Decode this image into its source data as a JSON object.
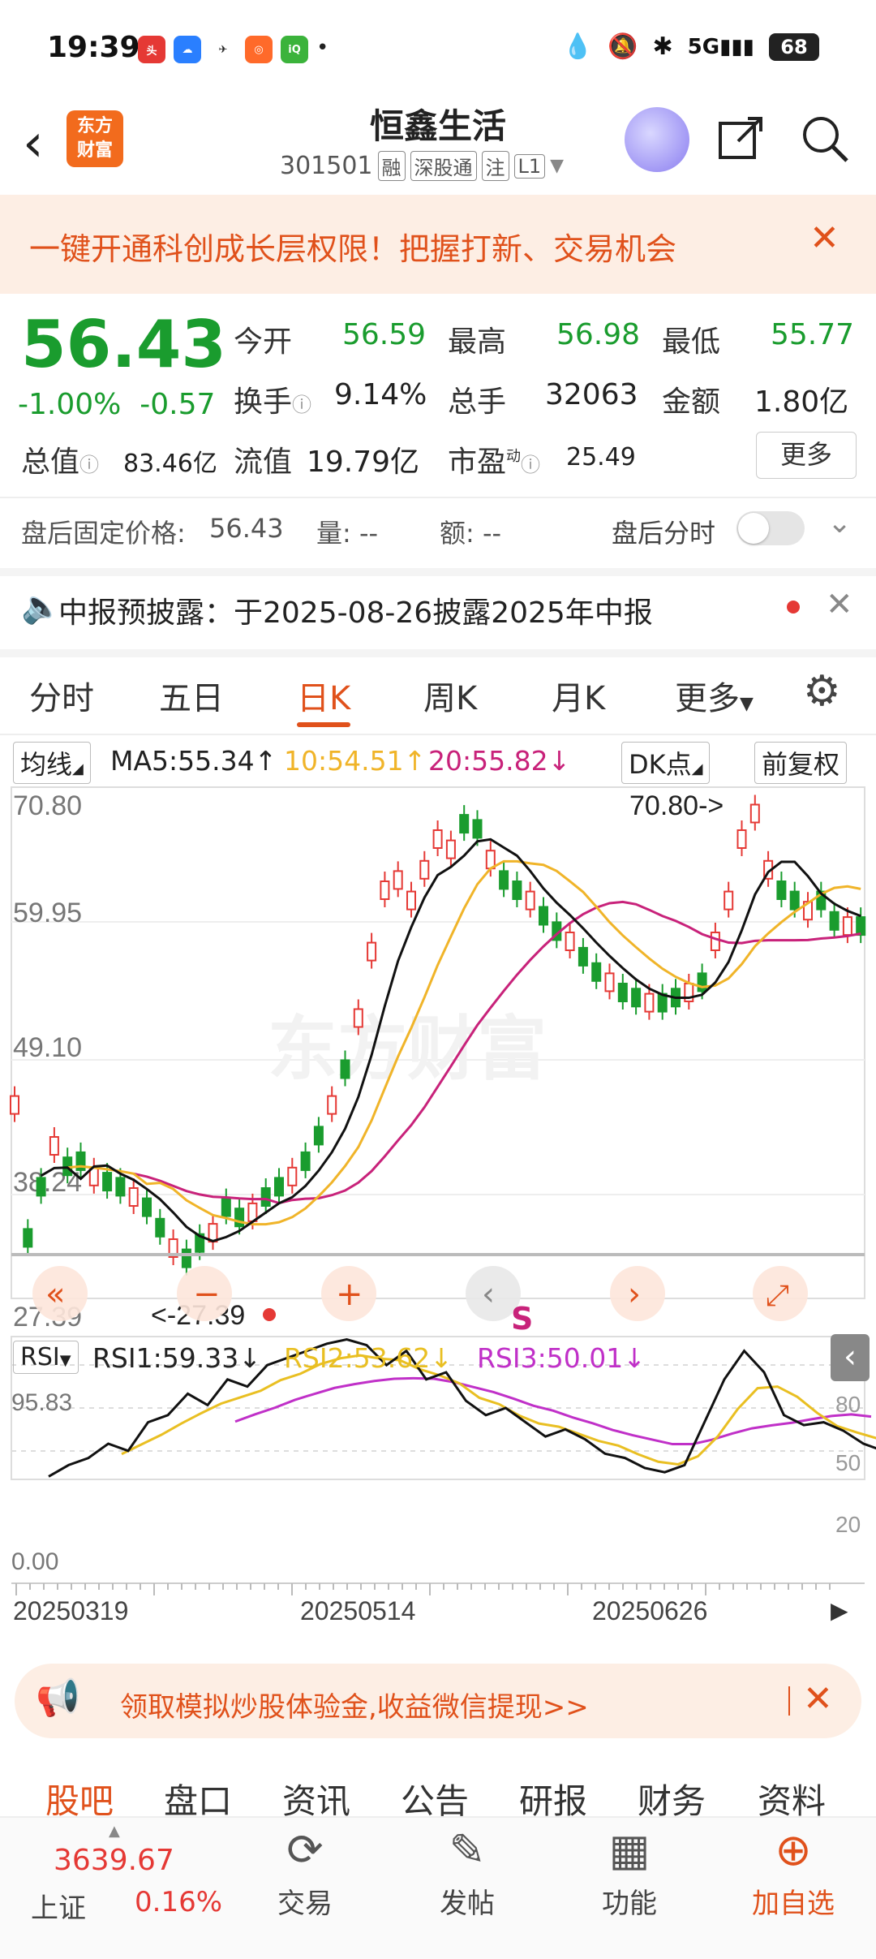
{
  "status": {
    "time": "19:39",
    "battery": "68",
    "network": "5G"
  },
  "header": {
    "title": "恒鑫生活",
    "code": "301501",
    "tags": [
      "融",
      "深股通",
      "注",
      "L1"
    ],
    "logo": "东方\n财富"
  },
  "banner": {
    "text": "一键开通科创成长层权限！把握打新、交易机会"
  },
  "quote": {
    "price": "56.43",
    "pct": "-1.00%",
    "change": "-0.57",
    "open_label": "今开",
    "open": "56.59",
    "high_label": "最高",
    "high": "56.98",
    "low_label": "最低",
    "low": "55.77",
    "turnover_label": "换手",
    "turnover": "9.14%",
    "volume_label": "总手",
    "volume": "32063",
    "amount_label": "金额",
    "amount": "1.80亿",
    "mcap_label": "总值",
    "mcap": "83.46亿",
    "float_label": "流值",
    "float": "19.79亿",
    "pe_label": "市盈",
    "pe_sup": "动",
    "pe": "25.49",
    "more": "更多"
  },
  "after_hours": {
    "label": "盘后固定价格:",
    "price": "56.43",
    "vol": "量: --",
    "amt": "额: --",
    "toggle_label": "盘后分时"
  },
  "notice": {
    "text": "中报预披露：于2025-08-26披露2025年中报"
  },
  "ktabs": [
    "分时",
    "五日",
    "日K",
    "周K",
    "月K",
    "更多"
  ],
  "ktabs_active": 2,
  "ma": {
    "label": "均线",
    "ma5": "MA5:55.34↑",
    "ma10": "10:54.51↑",
    "ma20": "20:55.82↓",
    "dk": "DK点",
    "fq": "前复权"
  },
  "kchart": {
    "price_ticks": [
      "70.80",
      "59.95",
      "49.10",
      "38.24",
      "27.39"
    ],
    "max_label": "70.80->",
    "min_label": "<-27.39",
    "watermark": "东方财富",
    "s_marker": "S"
  },
  "rsi": {
    "label": "RSI",
    "rsi1": "RSI1:59.33↓",
    "rsi2": "RSI2:53.62↓",
    "rsi3": "RSI3:50.01↓",
    "top": "95.83",
    "bottom": "0.00",
    "levels": [
      "80",
      "50",
      "20"
    ]
  },
  "dates": [
    "20250319",
    "20250514",
    "20250626"
  ],
  "promo": {
    "text": "领取模拟炒股体验金,收益微信提现>>"
  },
  "bottom_tabs": [
    "股吧",
    "盘口",
    "资讯",
    "公告",
    "研报",
    "财务",
    "资料"
  ],
  "nav": {
    "index_value": "3639.67",
    "index_name": "上证",
    "index_pct": "0.16%",
    "items": [
      "交易",
      "发帖",
      "功能",
      "加自选"
    ]
  },
  "colors": {
    "up": "#e53935",
    "down": "#1a9c2e",
    "accent": "#e0511b",
    "ma5": "#111111",
    "ma10": "#f0b429",
    "ma20": "#c8227a"
  }
}
